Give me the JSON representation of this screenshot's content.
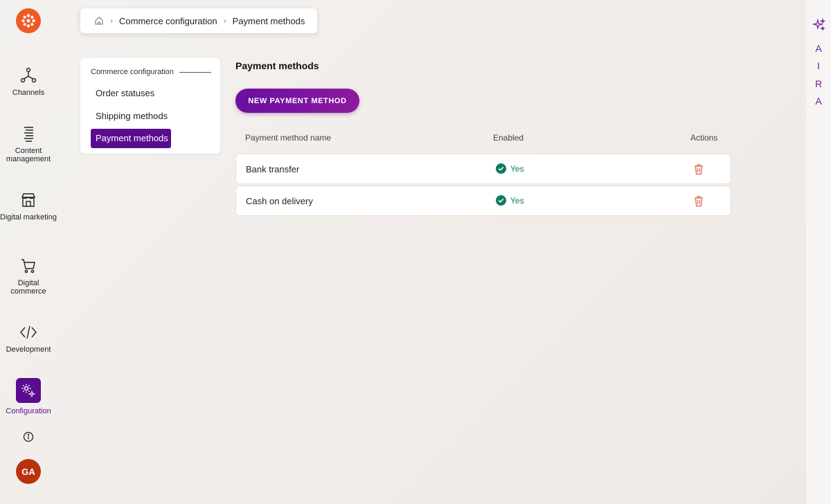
{
  "nav": {
    "items": [
      {
        "label": "Channels"
      },
      {
        "label": "Content management"
      },
      {
        "label": "Digital marketing"
      },
      {
        "label": "Digital commerce"
      },
      {
        "label": "Development"
      },
      {
        "label": "Configuration"
      }
    ],
    "avatar_initials": "GA"
  },
  "breadcrumb": {
    "items": [
      "Commerce configuration",
      "Payment methods"
    ]
  },
  "sidecard": {
    "group_title": "Commerce configuration",
    "items": [
      {
        "label": "Order statuses"
      },
      {
        "label": "Shipping methods"
      },
      {
        "label": "Payment methods"
      }
    ]
  },
  "main": {
    "title": "Payment methods",
    "new_button": "NEW PAYMENT METHOD",
    "table": {
      "headers": [
        "Payment method name",
        "Enabled",
        "Actions"
      ],
      "rows": [
        {
          "name": "Bank transfer",
          "enabled": "Yes"
        },
        {
          "name": "Cash on delivery",
          "enabled": "Yes"
        }
      ]
    }
  },
  "aira": {
    "letters": [
      "A",
      "I",
      "R",
      "A"
    ]
  },
  "colors": {
    "brand": "#ef5a24",
    "accent": "#5a0c8f",
    "success": "#0f7a5e",
    "danger": "#e05a4f"
  },
  "icons": [
    "logo-icon",
    "channels-icon",
    "content-icon",
    "marketing-icon",
    "cart-icon",
    "code-icon",
    "gear-icon",
    "info-icon",
    "home-icon",
    "check-circle-icon",
    "trash-icon",
    "sparkle-icon"
  ]
}
